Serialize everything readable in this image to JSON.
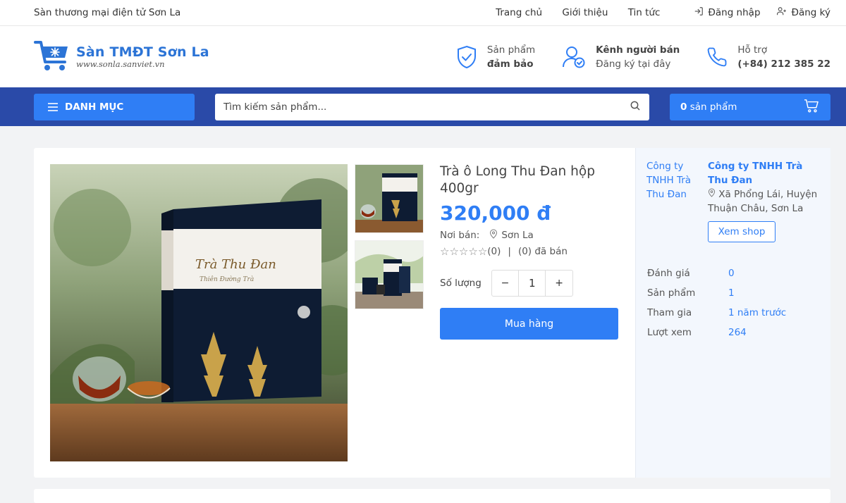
{
  "topbar": {
    "tagline": "Sàn thương mại điện tử Sơn La",
    "nav": [
      "Trang chủ",
      "Giới thiệu",
      "Tin tức"
    ],
    "login": "Đăng nhập",
    "register": "Đăng ký"
  },
  "header": {
    "logo_title": "Sàn TMĐT Sơn La",
    "logo_sub": "www.sonla.sanviet.vn",
    "features": [
      {
        "line1": "Sản phẩm",
        "line2": "đảm bảo",
        "icon": "shield-check-icon"
      },
      {
        "line1": "Kênh người bán",
        "line2": "Đăng ký tại đây",
        "icon": "user-check-icon"
      },
      {
        "line1": "Hỗ trợ",
        "line2": "(+84) 212 385 22",
        "icon": "phone-icon"
      }
    ]
  },
  "navbar": {
    "category_label": "DANH MỤC",
    "search_placeholder": "Tìm kiếm sản phẩm...",
    "cart_count": "0",
    "cart_label": "sản phẩm"
  },
  "product": {
    "title": "Trà ô Long Thu Đan hộp 400gr",
    "price": "320,000 đ",
    "seller_label": "Nơi bán:",
    "location": "Sơn La",
    "rating_count": "(0)",
    "separator": "|",
    "sold": "(0) đã bán",
    "rating_value": 0,
    "quantity_label": "Số lượng",
    "quantity": "1",
    "minus": "−",
    "plus": "+",
    "buy_label": "Mua hàng",
    "box_brand": "Trà Thu Đan",
    "box_sub": "Thiên Đường Trà"
  },
  "shop": {
    "logo_alt": "Công ty TNHH Trà Thu Đan",
    "name": "Công ty TNHH Trà Thu Đan",
    "address": "Xã Phổng Lái, Huyện Thuận Châu, Sơn La",
    "view_label": "Xem shop",
    "stats": [
      {
        "label": "Đánh giá",
        "value": "0"
      },
      {
        "label": "Sản phẩm",
        "value": "1"
      },
      {
        "label": "Tham gia",
        "value": "1 năm trước"
      },
      {
        "label": "Lượt xem",
        "value": "264"
      }
    ]
  },
  "colors": {
    "primary": "#2f7ef5",
    "navbar": "#2a4aa8",
    "logo": "#2c74d6"
  }
}
